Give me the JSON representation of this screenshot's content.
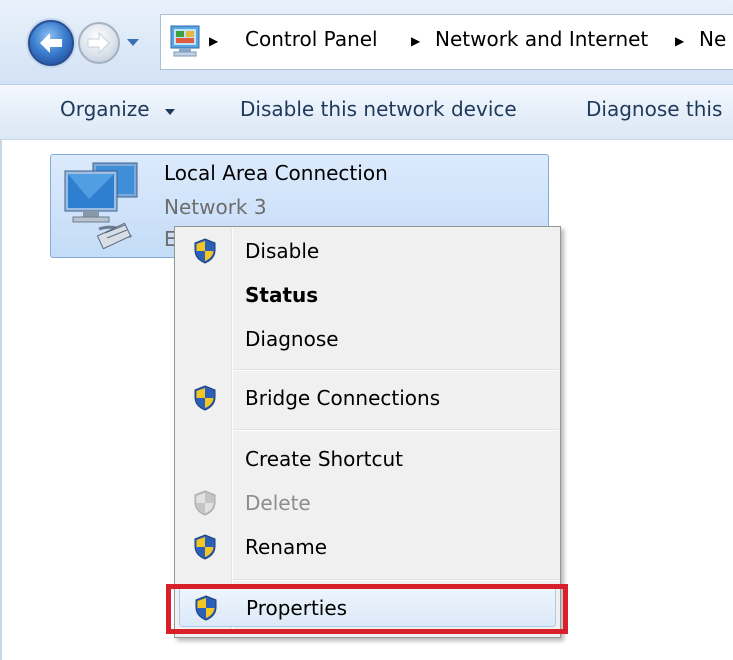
{
  "address_bar": {
    "back_icon": "back-arrow-icon",
    "forward_icon": "forward-arrow-icon",
    "breadcrumb": [
      "Control Panel",
      "Network and Internet",
      "Ne"
    ]
  },
  "command_bar": {
    "organize": "Organize",
    "disable_device": "Disable this network device",
    "diagnose": "Diagnose this"
  },
  "connection": {
    "name": "Local Area Connection",
    "network": "Network  3",
    "device": "E"
  },
  "context_menu": {
    "items": [
      {
        "label": "Disable",
        "icon": "uac-shield-icon",
        "bold": false,
        "enabled": true
      },
      {
        "label": "Status",
        "icon": "",
        "bold": true,
        "enabled": true
      },
      {
        "label": "Diagnose",
        "icon": "",
        "bold": false,
        "enabled": true
      },
      {
        "label": "Bridge Connections",
        "icon": "uac-shield-icon",
        "bold": false,
        "enabled": true
      },
      {
        "label": "Create Shortcut",
        "icon": "",
        "bold": false,
        "enabled": true
      },
      {
        "label": "Delete",
        "icon": "uac-shield-icon",
        "bold": false,
        "enabled": false
      },
      {
        "label": "Rename",
        "icon": "uac-shield-icon",
        "bold": false,
        "enabled": true
      },
      {
        "label": "Properties",
        "icon": "uac-shield-icon",
        "bold": false,
        "enabled": true,
        "highlighted": true
      }
    ]
  },
  "colors": {
    "highlight_border": "#d8202a",
    "selection": "#c4dcf7",
    "shield_blue": "#2b5fb8",
    "shield_yellow": "#f4c623"
  }
}
